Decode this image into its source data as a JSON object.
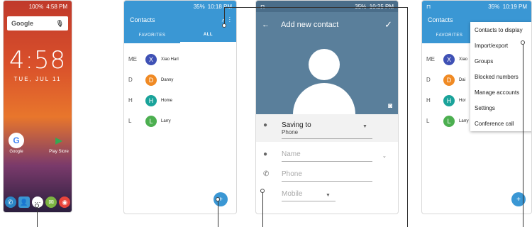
{
  "home": {
    "status": "100%",
    "status_time": "4:58 PM",
    "search_label": "Google",
    "clock": "4:58",
    "date": "TUE, JUL 11",
    "apps": [
      {
        "label": "Google"
      },
      {
        "label": "Play Store"
      }
    ],
    "dock": [
      "phone-icon",
      "contacts-icon",
      "apps-icon",
      "messages-icon",
      "chrome-icon"
    ]
  },
  "contacts": {
    "status": "35%",
    "status_time": "10:18 PM",
    "title": "Contacts",
    "tabs": [
      "FAVORITES",
      "ALL"
    ],
    "rows": [
      {
        "letter": "ME",
        "initial": "X",
        "name": "Xiao Harl",
        "color": "#3f51b5"
      },
      {
        "letter": "D",
        "initial": "D",
        "name": "Danny",
        "color": "#f08a24"
      },
      {
        "letter": "H",
        "initial": "H",
        "name": "Home",
        "color": "#1aa39a"
      },
      {
        "letter": "L",
        "initial": "L",
        "name": "Larry",
        "color": "#4caf50"
      }
    ]
  },
  "add_contact": {
    "status": "35%",
    "status_time": "10:25 PM",
    "title": "Add new contact",
    "saving_label": "Saving to",
    "saving_value": "Phone",
    "name_placeholder": "Name",
    "phone_placeholder": "Phone",
    "phone_type": "Mobile"
  },
  "menu_screen": {
    "status": "35%",
    "status_time": "10:19 PM",
    "title": "Contacts",
    "tab": "FAVORITES",
    "rows": [
      {
        "letter": "ME",
        "initial": "X",
        "name": "Xiao",
        "color": "#3f51b5"
      },
      {
        "letter": "D",
        "initial": "D",
        "name": "Dai",
        "color": "#f08a24"
      },
      {
        "letter": "H",
        "initial": "H",
        "name": "Hor",
        "color": "#1aa39a"
      },
      {
        "letter": "L",
        "initial": "L",
        "name": "Larry",
        "color": "#4caf50"
      }
    ],
    "menu": [
      "Contacts to display",
      "Import/export",
      "Groups",
      "Blocked numbers",
      "Manage accounts",
      "Settings",
      "Conference call"
    ]
  },
  "colors": {
    "accent": "#3a97d4",
    "toolbar": "#5a7f9b"
  }
}
